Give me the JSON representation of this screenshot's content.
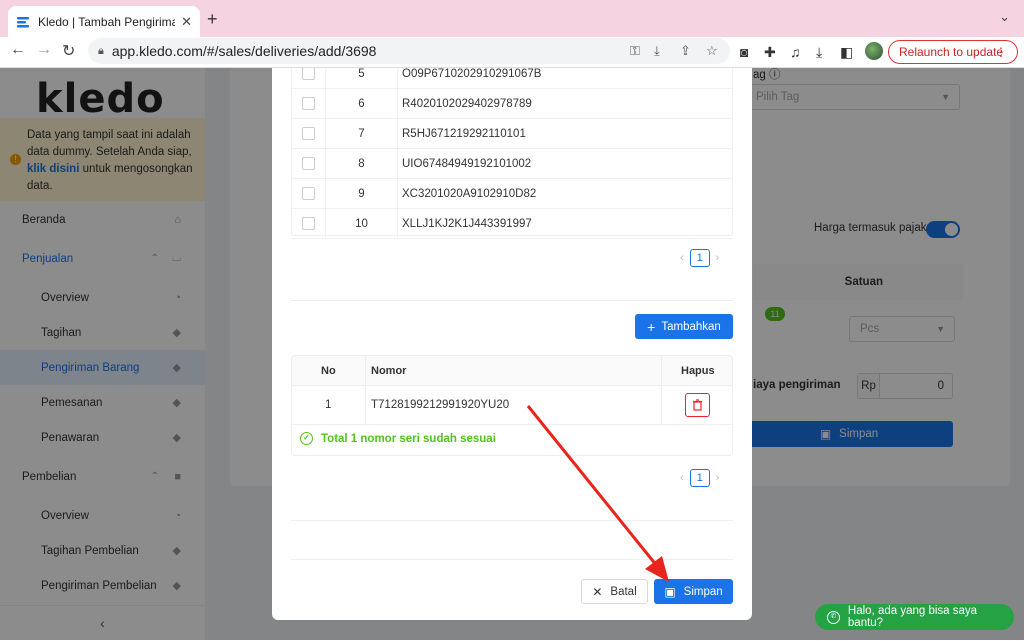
{
  "browser": {
    "tab_title": "Kledo | Tambah Pengiriman Ba",
    "url": "app.kledo.com/#/sales/deliveries/add/3698",
    "relaunch_label": "Relaunch to update"
  },
  "sidebar": {
    "logo": "kledo",
    "notice": {
      "text_before": "Data yang tampil saat ini adalah data dummy. Setelah Anda siap, ",
      "link": "klik disini",
      "text_after": " untuk mengosongkan data."
    },
    "items": [
      {
        "label": "Beranda"
      },
      {
        "label": "Penjualan"
      },
      {
        "label": "Overview"
      },
      {
        "label": "Tagihan"
      },
      {
        "label": "Pengiriman Barang"
      },
      {
        "label": "Pemesanan"
      },
      {
        "label": "Penawaran"
      },
      {
        "label": "Pembelian"
      },
      {
        "label": "Overview"
      },
      {
        "label": "Tagihan Pembelian"
      },
      {
        "label": "Pengiriman Pembelian"
      }
    ],
    "collapse_icon": "chevron-left-icon"
  },
  "background": {
    "tag_label": "ag",
    "tag_placeholder": "Pilih Tag",
    "harga_label": "Harga termasuk pajak",
    "satuan_header": "Satuan",
    "qty_badge": "11",
    "unit_placeholder": "Pcs",
    "shipping_label": "iaya pengiriman",
    "currency": "Rp",
    "shipping_value": "0",
    "save_label": "Simpan"
  },
  "modal": {
    "available_rows": [
      {
        "no": "5",
        "serial": "O09P6710202910291067B"
      },
      {
        "no": "6",
        "serial": "R4020102029402978789"
      },
      {
        "no": "7",
        "serial": "R5HJ671219292110101"
      },
      {
        "no": "8",
        "serial": "UIO67484949192101002"
      },
      {
        "no": "9",
        "serial": "XC3201020A9102910D82"
      },
      {
        "no": "10",
        "serial": "XLLJ1KJ2K1J443391997"
      }
    ],
    "page_1": "1",
    "add_button": "Tambahkan",
    "selected_table": {
      "headers": {
        "no": "No",
        "nomor": "Nomor",
        "hapus": "Hapus"
      },
      "rows": [
        {
          "no": "1",
          "serial": "T7128199212991920YU20"
        }
      ],
      "success_text": "Total 1 nomor seri sudah sesuai"
    },
    "page_2": "1",
    "cancel_button": "Batal",
    "save_button": "Simpan"
  },
  "chat": {
    "label": "Halo, ada yang bisa saya bantu?"
  },
  "colors": {
    "primary": "#1a73e8",
    "success": "#52c41a",
    "danger": "#f5222d",
    "annotation_arrow": "#e8241c"
  }
}
